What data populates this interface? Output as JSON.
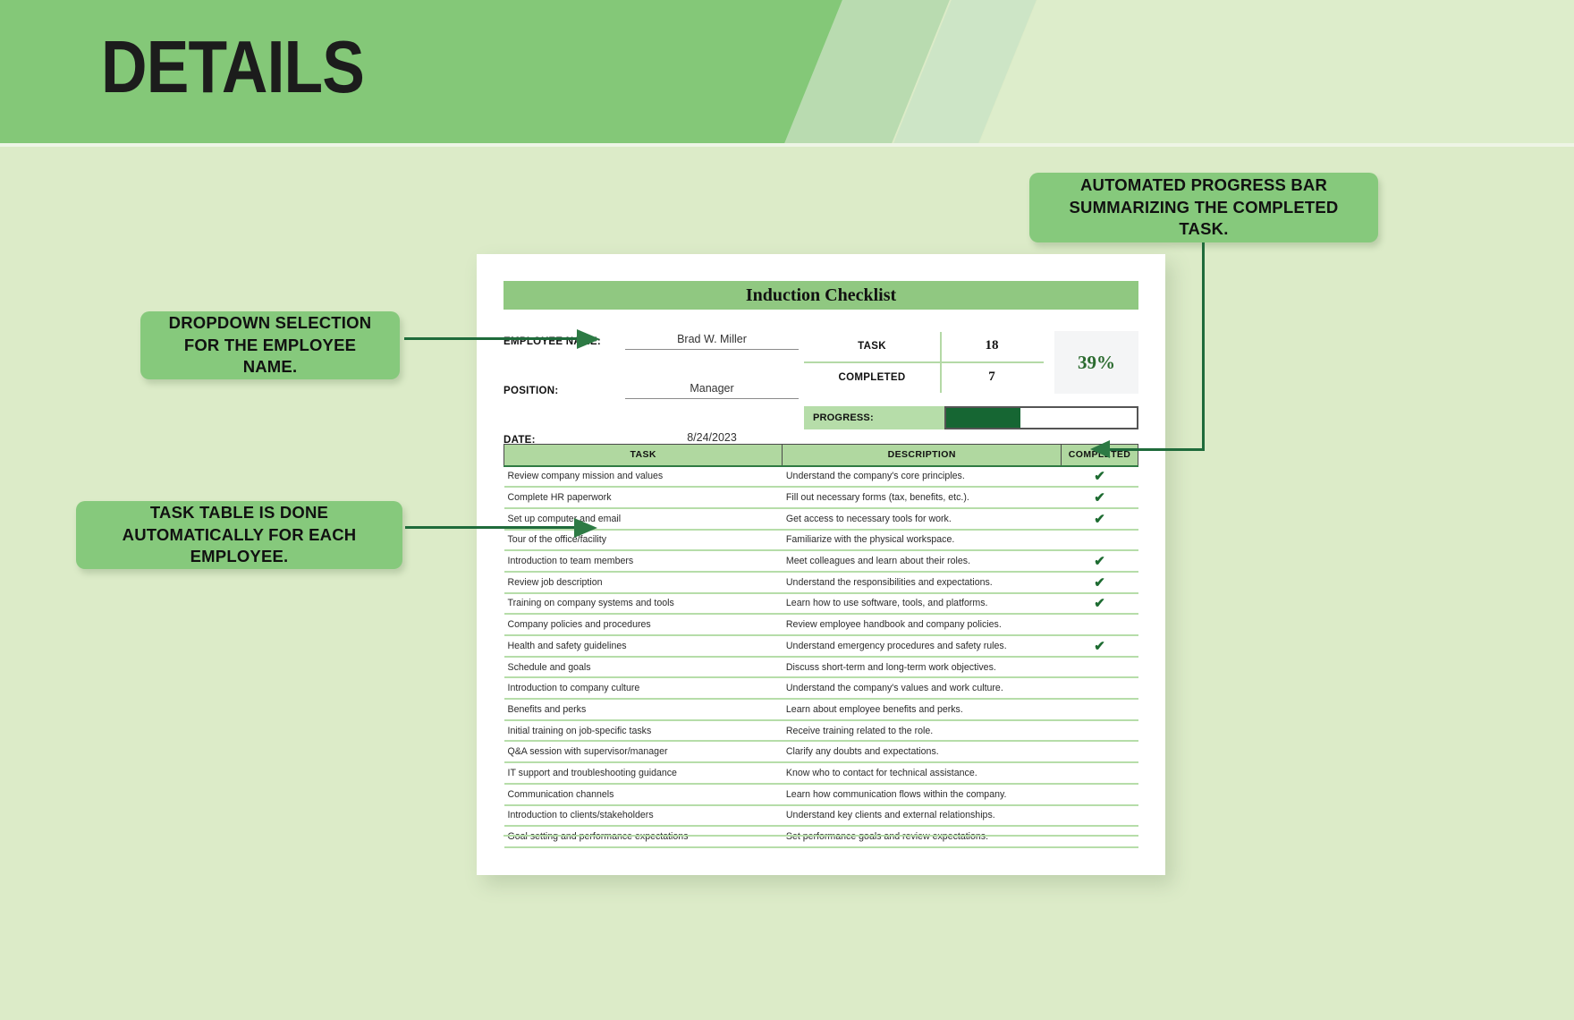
{
  "banner": {
    "title": "DETAILS"
  },
  "callouts": {
    "progress": "AUTOMATED PROGRESS BAR SUMMARIZING THE COMPLETED TASK.",
    "dropdown": "DROPDOWN SELECTION FOR THE EMPLOYEE NAME.",
    "table": "TASK TABLE IS DONE AUTOMATICALLY FOR EACH EMPLOYEE."
  },
  "document": {
    "title": "Induction Checklist",
    "info": [
      {
        "label": "EMPLOYEE NAME:",
        "value": "Brad W. Miller"
      },
      {
        "label": "POSITION:",
        "value": "Manager"
      },
      {
        "label": "DATE:",
        "value": "8/24/2023"
      }
    ],
    "stats": [
      {
        "name": "TASK",
        "value": "18"
      },
      {
        "name": "COMPLETED",
        "value": "7"
      }
    ],
    "percent_label": "39%",
    "percent_value": 39,
    "progress": {
      "label": "PROGRESS:",
      "fill_percent": 39
    },
    "table": {
      "headers": [
        "TASK",
        "DESCRIPTION",
        "COMPLETED"
      ],
      "check_glyph": "✔",
      "rows": [
        {
          "task": "Review company mission and values",
          "description": "Understand the company's core principles.",
          "completed": true
        },
        {
          "task": "Complete HR paperwork",
          "description": "Fill out necessary forms (tax, benefits, etc.).",
          "completed": true
        },
        {
          "task": "Set up computer and email",
          "description": "Get access to necessary tools for work.",
          "completed": true
        },
        {
          "task": "Tour of the office/facility",
          "description": "Familiarize with the physical workspace.",
          "completed": false
        },
        {
          "task": "Introduction to team members",
          "description": "Meet colleagues and learn about their roles.",
          "completed": true
        },
        {
          "task": "Review job description",
          "description": "Understand the responsibilities and expectations.",
          "completed": true
        },
        {
          "task": "Training on company systems and tools",
          "description": "Learn how to use software, tools, and platforms.",
          "completed": true
        },
        {
          "task": "Company policies and procedures",
          "description": "Review employee handbook and company policies.",
          "completed": false
        },
        {
          "task": "Health and safety guidelines",
          "description": "Understand emergency procedures and safety rules.",
          "completed": true
        },
        {
          "task": "Schedule and goals",
          "description": "Discuss short-term and long-term work objectives.",
          "completed": false
        },
        {
          "task": "Introduction to company culture",
          "description": "Understand the company's values and work culture.",
          "completed": false
        },
        {
          "task": "Benefits and perks",
          "description": "Learn about employee benefits and perks.",
          "completed": false
        },
        {
          "task": "Initial training on job-specific tasks",
          "description": "Receive training related to the role.",
          "completed": false
        },
        {
          "task": "Q&A session with supervisor/manager",
          "description": "Clarify any doubts and expectations.",
          "completed": false
        },
        {
          "task": "IT support and troubleshooting guidance",
          "description": "Know who to contact for technical assistance.",
          "completed": false
        },
        {
          "task": "Communication channels",
          "description": "Learn how communication flows within the company.",
          "completed": false
        },
        {
          "task": "Introduction to clients/stakeholders",
          "description": "Understand key clients and external relationships.",
          "completed": false
        },
        {
          "task": "Goal setting and performance expectations",
          "description": "Set performance goals and review expectations.",
          "completed": false
        }
      ]
    }
  },
  "colors": {
    "background": "#dcebc8",
    "banner_green": "#84c878",
    "callout_green": "#86c97c",
    "header_green": "#b0d8a0",
    "title_green": "#90c881",
    "progress_fill": "#166633",
    "connector": "#1f6b3b",
    "percent_text": "#2b6b2f"
  }
}
